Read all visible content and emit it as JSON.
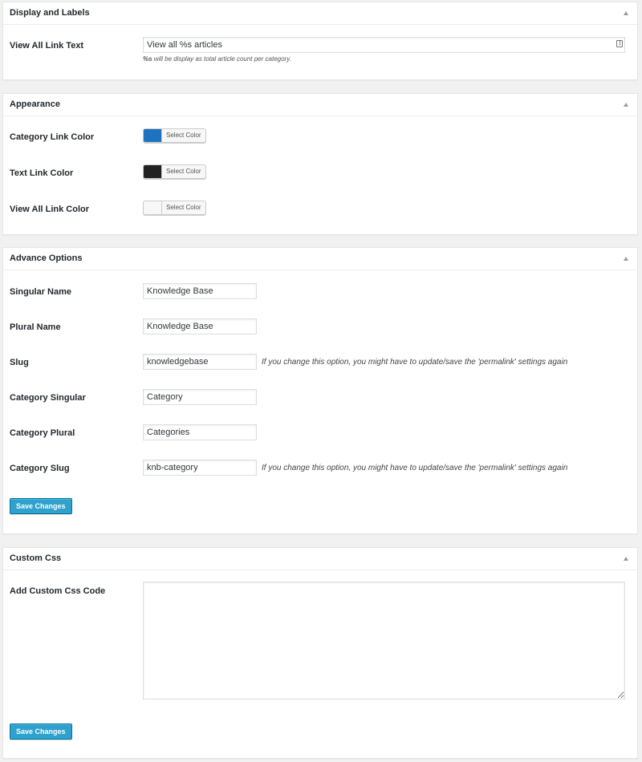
{
  "panels": {
    "display": {
      "title": "Display and Labels",
      "view_all_label": "View All Link Text",
      "view_all_value": "View all %s articles",
      "help_token": "%s",
      "help_text": " will be display as total article count per category."
    },
    "appearance": {
      "title": "Appearance",
      "rows": [
        {
          "label": "Category Link Color",
          "color": "#1e73be",
          "button": "Select Color"
        },
        {
          "label": "Text Link Color",
          "color": "#222222",
          "button": "Select Color"
        },
        {
          "label": "View All Link Color",
          "color": "#f7f7f7",
          "button": "Select Color"
        }
      ]
    },
    "advance": {
      "title": "Advance Options",
      "rows": [
        {
          "label": "Singular Name",
          "value": "Knowledge Base"
        },
        {
          "label": "Plural Name",
          "value": "Knowledge Base"
        },
        {
          "label": "Slug",
          "value": "knowledgebase",
          "note": "If you change this option, you might have to update/save the 'permalink' settings again"
        },
        {
          "label": "Category Singular",
          "value": "Category"
        },
        {
          "label": "Category Plural",
          "value": "Categories"
        },
        {
          "label": "Category Slug",
          "value": "knb-category",
          "note": "If you change this option, you might have to update/save the 'permalink' settings again"
        }
      ],
      "save_label": "Save Changes"
    },
    "custom_css": {
      "title": "Custom Css",
      "label": "Add Custom Css Code",
      "value": "",
      "save_label": "Save Changes"
    }
  },
  "colors": {
    "primary_button": "#2ea2cc",
    "page_background": "#f1f1f1"
  }
}
